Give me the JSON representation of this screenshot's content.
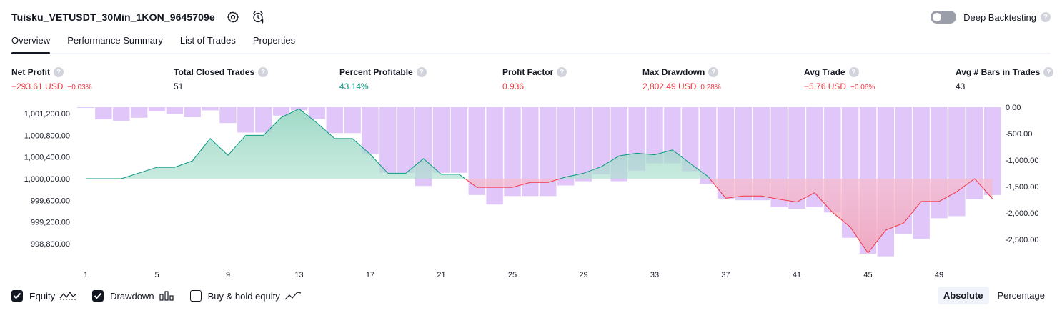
{
  "header": {
    "title": "Tuisku_VETUSDT_30Min_1KON_9645709e",
    "deep_backtesting_label": "Deep Backtesting",
    "help_glyph": "?"
  },
  "tabs": [
    {
      "label": "Overview",
      "active": true
    },
    {
      "label": "Performance Summary",
      "active": false
    },
    {
      "label": "List of Trades",
      "active": false
    },
    {
      "label": "Properties",
      "active": false
    }
  ],
  "stats": [
    {
      "label": "Net Profit",
      "value": "−293.61 USD",
      "sub": "−0.03%",
      "tone": "neg"
    },
    {
      "label": "Total Closed Trades",
      "value": "51",
      "sub": "",
      "tone": "neu"
    },
    {
      "label": "Percent Profitable",
      "value": "43.14%",
      "sub": "",
      "tone": "pos"
    },
    {
      "label": "Profit Factor",
      "value": "0.936",
      "sub": "",
      "tone": "neg"
    },
    {
      "label": "Max Drawdown",
      "value": "2,802.49 USD",
      "sub": "0.28%",
      "tone": "neg"
    },
    {
      "label": "Avg Trade",
      "value": "−5.76 USD",
      "sub": "−0.06%",
      "tone": "neg"
    },
    {
      "label": "Avg # Bars in Trades",
      "value": "43",
      "sub": "",
      "tone": "neu"
    }
  ],
  "colors": {
    "positive": "#089981",
    "negative": "#f23645",
    "drawdown_bar": "#e1c6fa",
    "equity_up_fill": "#d3eee5",
    "equity_down_fill": "#f2a3b7"
  },
  "chart_data": {
    "type": "line",
    "x_ticks": [
      "1",
      "5",
      "9",
      "13",
      "17",
      "21",
      "25",
      "29",
      "33",
      "37",
      "41",
      "45",
      "49"
    ],
    "y_left_ticks": [
      "1,001,200.00",
      "1,000,800.00",
      "1,000,400.00",
      "1,000,000.00",
      "999,600.00",
      "999,200.00",
      "998,800.00"
    ],
    "y_right_ticks": [
      "0.00",
      "-500.00",
      "-1,000.00",
      "-1,500.00",
      "-2,000.00",
      "-2,500.00"
    ],
    "baseline": 1000000,
    "series": [
      {
        "name": "Equity",
        "x": [
          1,
          3,
          5,
          6,
          7,
          8,
          9,
          10,
          11,
          12,
          13,
          14,
          15,
          16,
          17,
          18,
          19,
          20,
          21,
          22,
          23,
          24,
          25,
          26,
          27,
          28,
          29,
          30,
          31,
          32,
          33,
          34,
          35,
          36,
          37,
          38,
          39,
          40,
          41,
          42,
          43,
          44,
          45,
          46,
          47,
          48,
          49,
          50,
          51,
          52
        ],
        "values": [
          1000000,
          1000000,
          1000210,
          1000210,
          1000330,
          1000740,
          1000430,
          1000800,
          1000800,
          1001130,
          1001290,
          1001030,
          1000740,
          1000740,
          1000450,
          1000100,
          1000100,
          1000370,
          1000080,
          1000080,
          999840,
          999840,
          999840,
          999930,
          999930,
          1000030,
          1000100,
          1000220,
          1000420,
          1000470,
          1000440,
          1000530,
          1000280,
          1000040,
          999640,
          999680,
          999680,
          999620,
          999570,
          999740,
          999380,
          999110,
          998630,
          999050,
          999180,
          999580,
          999580,
          999760,
          1000000,
          999630
        ]
      },
      {
        "name": "Drawdown",
        "x": [
          1,
          2,
          3,
          4,
          5,
          6,
          7,
          8,
          9,
          10,
          11,
          12,
          13,
          14,
          15,
          16,
          17,
          18,
          19,
          20,
          21,
          22,
          23,
          24,
          25,
          26,
          27,
          28,
          29,
          30,
          31,
          32,
          33,
          34,
          35,
          36,
          37,
          38,
          39,
          40,
          41,
          42,
          43,
          44,
          45,
          46,
          47,
          48,
          49,
          50,
          51,
          52
        ],
        "values": [
          0,
          -230,
          -260,
          -200,
          -80,
          -130,
          -190,
          -60,
          -300,
          -480,
          -480,
          -160,
          -60,
          -220,
          -490,
          -490,
          -890,
          -1240,
          -1240,
          -1490,
          -1240,
          -1240,
          -1660,
          -1840,
          -1680,
          -1680,
          -1680,
          -1480,
          -1400,
          -1270,
          -1400,
          -1200,
          -1060,
          -1060,
          -1210,
          -1450,
          -1730,
          -1760,
          -1760,
          -1890,
          -1920,
          -1890,
          -1990,
          -2470,
          -2770,
          -2820,
          -2400,
          -2490,
          -2100,
          -2060,
          -1740,
          -1660
        ]
      }
    ]
  },
  "legend": [
    {
      "label": "Equity",
      "checked": true
    },
    {
      "label": "Drawdown",
      "checked": true
    },
    {
      "label": "Buy & hold equity",
      "checked": false
    }
  ],
  "mode_buttons": [
    {
      "label": "Absolute",
      "active": true
    },
    {
      "label": "Percentage",
      "active": false
    }
  ]
}
